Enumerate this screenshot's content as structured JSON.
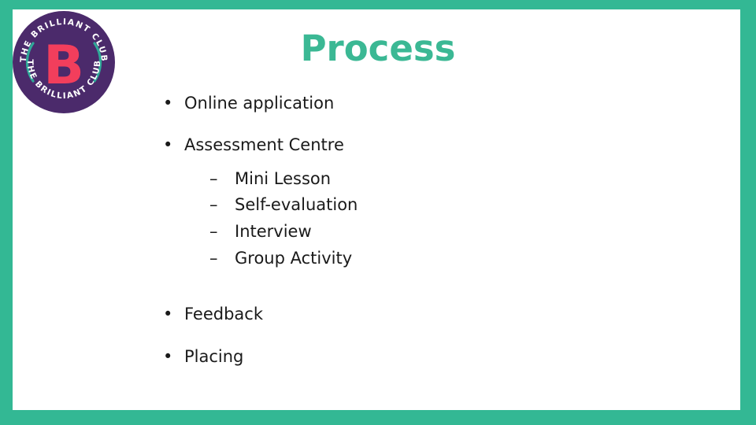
{
  "slide": {
    "title": "Process",
    "title_color": "#3bb894",
    "frame_color": "#33b894",
    "background_color": "#ffffff",
    "text_color": "#1a1a1a"
  },
  "logo": {
    "name": "the-brilliant-club-logo",
    "top_arc_text": "THE BRILLIANT CLUB",
    "bottom_arc_text": "THE BRILLIANT CLUB",
    "monogram": "B",
    "circle_color": "#4b2a6b",
    "monogram_color": "#f23e5c",
    "arc_accent_color": "#2fa898",
    "arc_text_color": "#ffffff"
  },
  "bullets": {
    "marker_level1": "•",
    "marker_level2": "–",
    "items": [
      {
        "label": "Online application"
      },
      {
        "label": "Assessment Centre"
      },
      {
        "label": "Feedback"
      },
      {
        "label": "Placing"
      }
    ],
    "sub_items": [
      {
        "label": "Mini Lesson"
      },
      {
        "label": "Self-evaluation"
      },
      {
        "label": "Interview"
      },
      {
        "label": "Group Activity"
      }
    ]
  }
}
